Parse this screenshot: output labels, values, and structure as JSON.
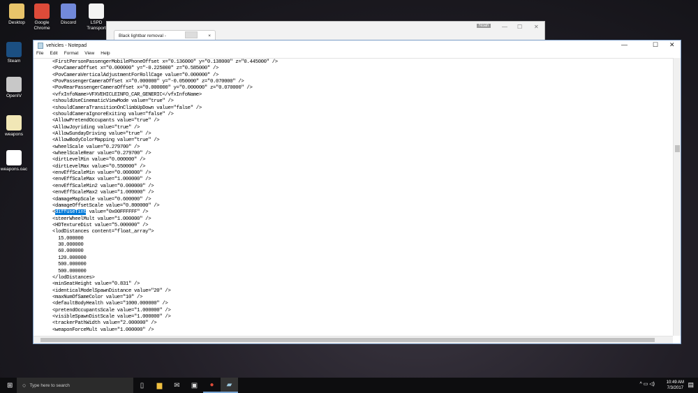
{
  "desktop": {
    "icons": [
      {
        "label": "Desktop",
        "color": "#e8c46a"
      },
      {
        "label": "Google Chrome",
        "color": "#dd4b39"
      },
      {
        "label": "Discord",
        "color": "#7289da"
      },
      {
        "label": "LSPD Transport",
        "color": "#f4f4f4"
      },
      {
        "label": "Steam",
        "color": "#1b4f82"
      },
      {
        "label": "OpenIV",
        "color": "#c8c8c8"
      },
      {
        "label": "weapons",
        "color": "#f1e7b6"
      },
      {
        "label": "weapons.oac",
        "color": "#ffffff"
      }
    ]
  },
  "browser": {
    "tab_title": "Black lightbar removal -",
    "tab_close": "×",
    "profile": "Noah",
    "min": "—",
    "max": "☐",
    "close": "✕"
  },
  "notepad": {
    "title": "vehicles - Notepad",
    "min": "—",
    "max": "☐",
    "close": "✕",
    "menu": [
      "File",
      "Edit",
      "Format",
      "View",
      "Help"
    ],
    "lines": [
      "<FirstPersonPassengerMobilePhoneOffset x=\"0.136000\" y=\"0.138000\" z=\"0.445000\" />",
      "<PovCameraOffset x=\"0.000000\" y=\"-0.225000\" z=\"0.585000\" />",
      "<PovCameraVerticalAdjustmentForRollCage value=\"0.000000\" />",
      "<PovPassengerCameraOffset x=\"0.000000\" y=\"-0.050000\" z=\"0.070000\" />",
      "<PovRearPassengerCameraOffset x=\"0.000000\" y=\"0.000000\" z=\"0.070000\" />",
      "<vfxInfoName>VFXVEHICLEINFO_CAR_GENERIC</vfxInfoName>",
      "<shouldUseCinematicViewMode value=\"true\" />",
      "<shouldCameraTransitionOnClimbUpDown value=\"false\" />",
      "<shouldCameraIgnoreExiting value=\"false\" />",
      "<AllowPretendOccupants value=\"true\" />",
      "<AllowJoyriding value=\"true\" />",
      "<AllowSundayDriving value=\"true\" />",
      "<AllowBodyColorMapping value=\"true\" />",
      "<wheelScale value=\"0.279700\" />",
      "<wheelScaleRear value=\"0.279700\" />",
      "<dirtLevelMin value=\"0.000000\" />",
      "<dirtLevelMax value=\"0.550000\" />",
      "<envEffScaleMin value=\"0.000000\" />",
      "<envEffScaleMax value=\"1.000000\" />",
      "<envEffScaleMin2 value=\"0.000000\" />",
      "<envEffScaleMax2 value=\"1.000000\" />",
      "<damageMapScale value=\"0.600000\" />",
      "<damageOffsetScale value=\"0.800000\" />",
      {
        "pre": "<",
        "sel": "diffuseTint",
        "post": " value=\"0x00FFFFFF\" />"
      },
      "<steerWheelMult value=\"1.000000\" />",
      "<HDTextureDist value=\"5.000000\" />",
      "<lodDistances content=\"float_array\">",
      "  15.000000",
      "  30.000000",
      "  60.000000",
      "  120.000000",
      "  500.000000",
      "  500.000000",
      "</lodDistances>",
      "<minSeatHeight value=\"0.831\" />",
      "<identicalModelSpawnDistance value=\"20\" />",
      "<maxNumOfSameColor value=\"10\" />",
      "<defaultBodyHealth value=\"1000.000000\" />",
      "<pretendOccupantsScale value=\"1.000000\" />",
      "<visibleSpawnDistScale value=\"1.000000\" />",
      "<trackerPathWidth value=\"2.000000\" />",
      "<weaponForceMult value=\"1.000000\" />"
    ]
  },
  "taskbar": {
    "search_placeholder": "Type here to search",
    "time": "10:49 AM",
    "date": "7/3/2017"
  }
}
